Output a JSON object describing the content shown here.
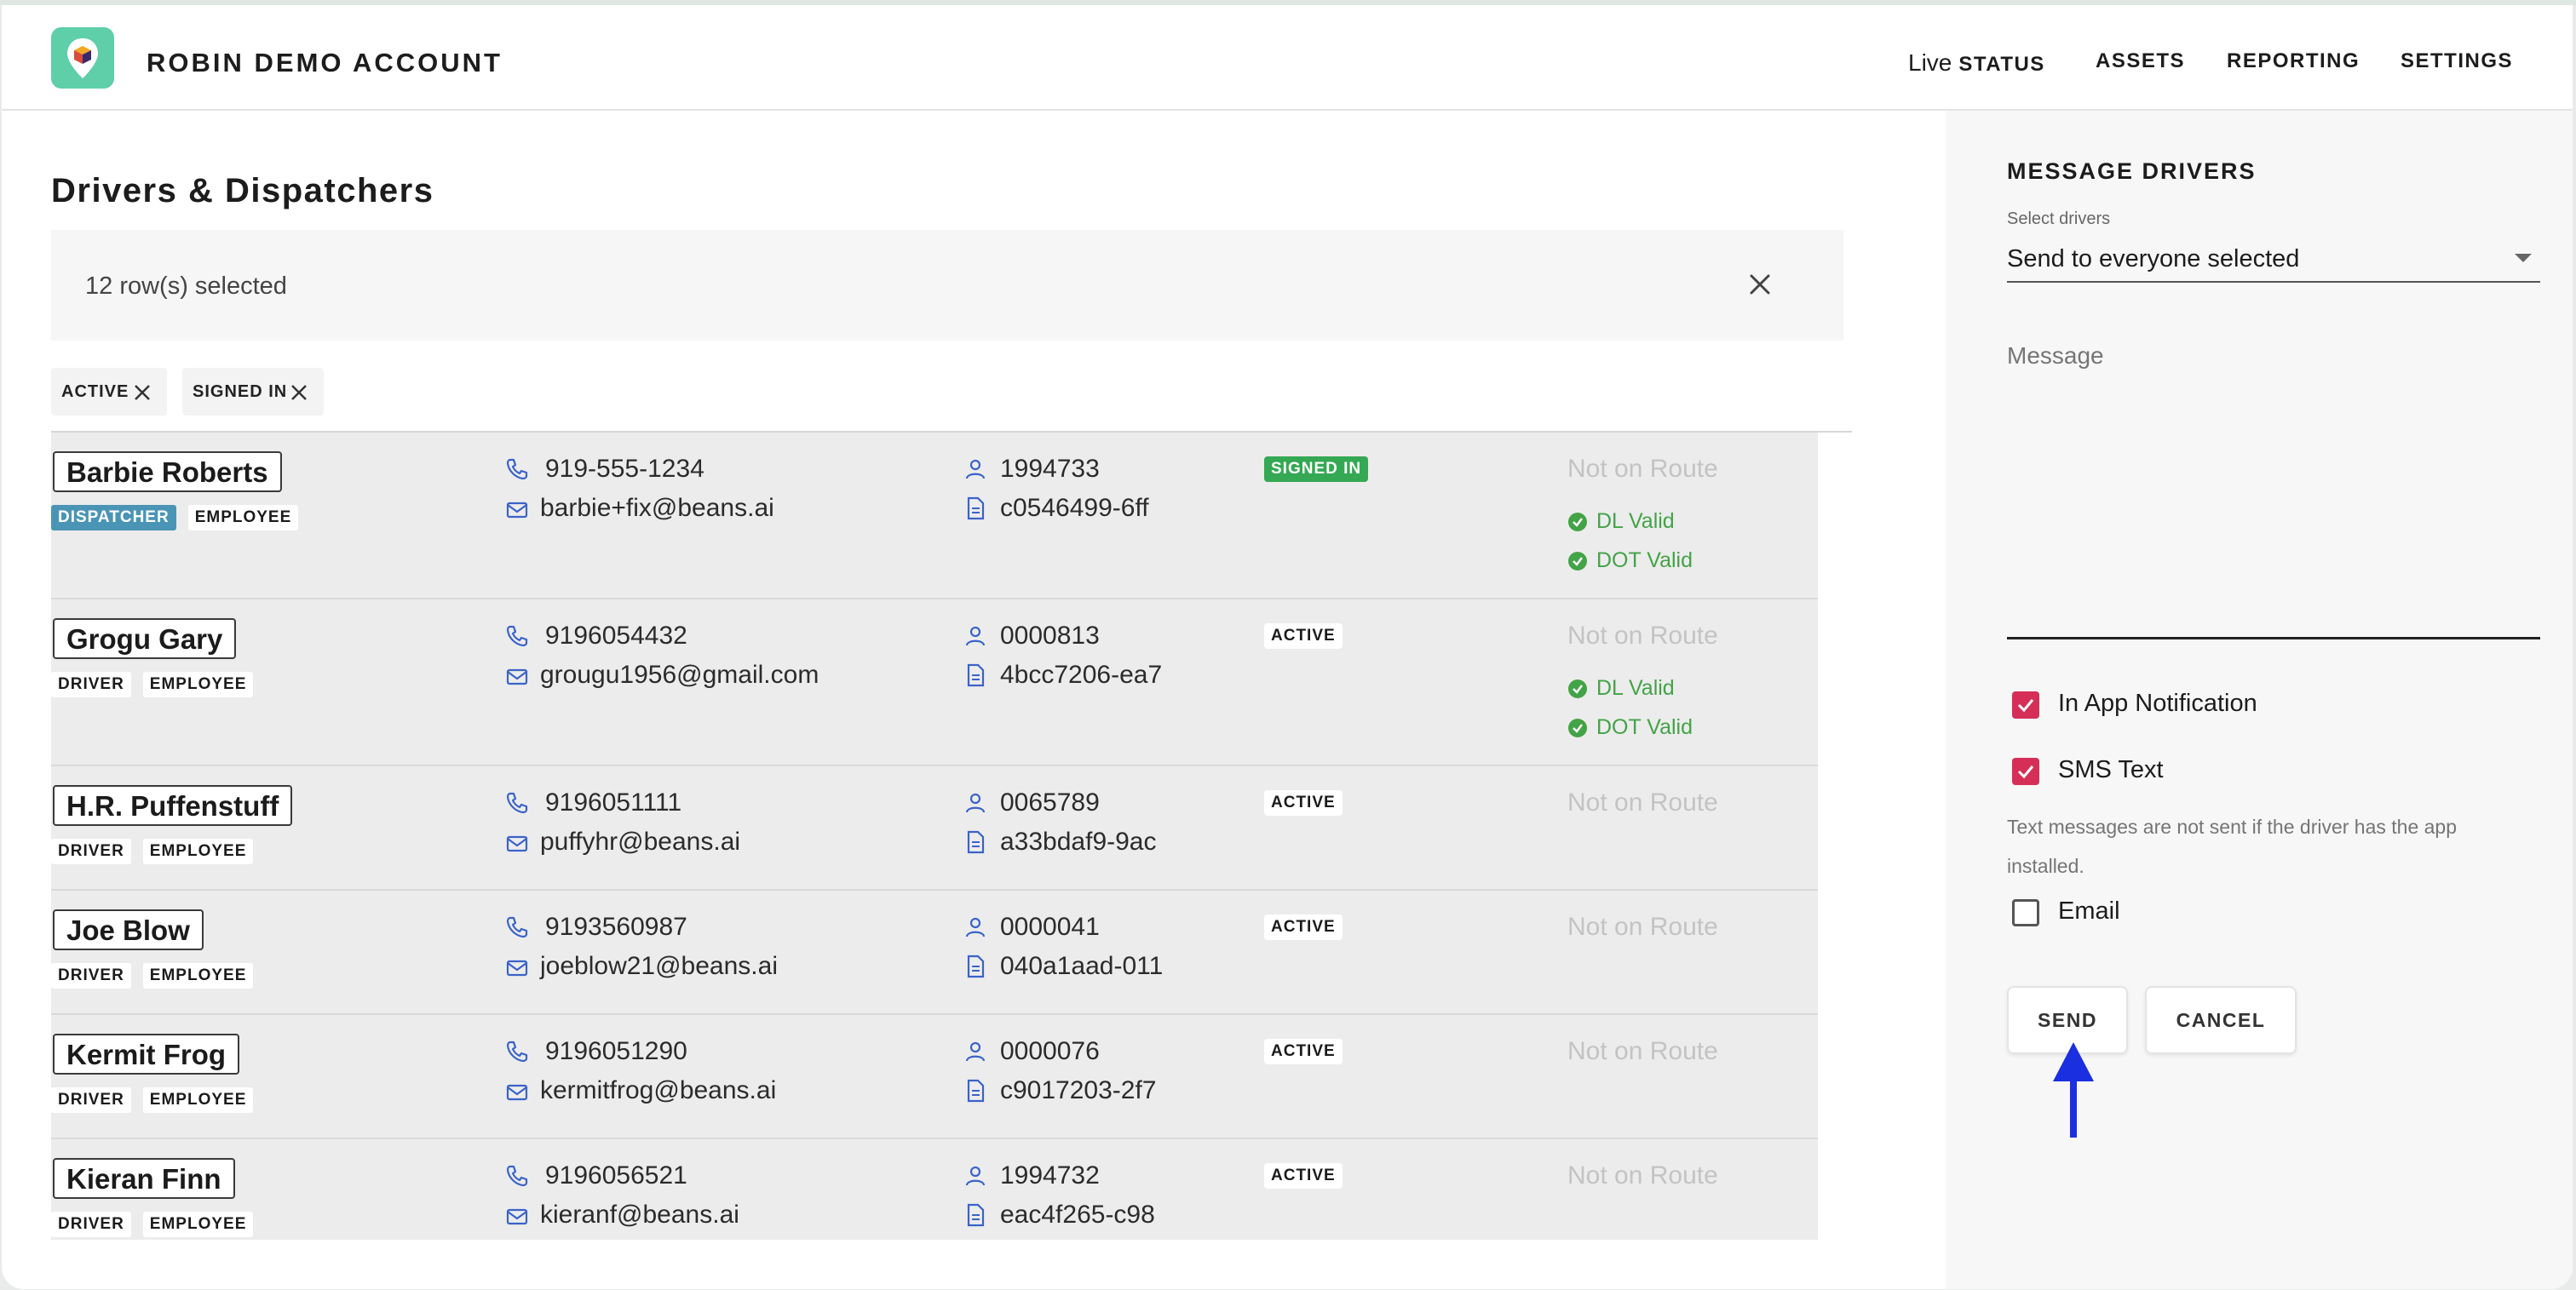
{
  "header": {
    "brand": "ROBIN DEMO ACCOUNT",
    "nav": [
      {
        "prefix": "Live",
        "label": "STATUS"
      },
      {
        "label": "ASSETS"
      },
      {
        "label": "REPORTING"
      },
      {
        "label": "SETTINGS"
      }
    ]
  },
  "main": {
    "title": "Drivers & Dispatchers",
    "selection_text": "12 row(s) selected",
    "filters": [
      "ACTIVE",
      "SIGNED IN"
    ]
  },
  "rows": [
    {
      "name": "Barbie Roberts",
      "tags": [
        "DISPATCHER",
        "EMPLOYEE"
      ],
      "phone": "919-555-1234",
      "email": "barbie+fix@beans.ai",
      "user_id": "1994733",
      "doc_id": "c0546499-6ff",
      "status": "SIGNED IN",
      "route": "Not on Route",
      "dl": "DL Valid",
      "dot": "DOT Valid"
    },
    {
      "name": "Grogu Gary",
      "tags": [
        "DRIVER",
        "EMPLOYEE"
      ],
      "phone": "9196054432",
      "email": "grougu1956@gmail.com",
      "user_id": "0000813",
      "doc_id": "4bcc7206-ea7",
      "status": "ACTIVE",
      "route": "Not on Route",
      "dl": "DL Valid",
      "dot": "DOT Valid"
    },
    {
      "name": "H.R. Puffenstuff",
      "tags": [
        "DRIVER",
        "EMPLOYEE"
      ],
      "phone": "9196051111",
      "email": "puffyhr@beans.ai",
      "user_id": "0065789",
      "doc_id": "a33bdaf9-9ac",
      "status": "ACTIVE",
      "route": "Not on Route"
    },
    {
      "name": "Joe Blow",
      "tags": [
        "DRIVER",
        "EMPLOYEE"
      ],
      "phone": "9193560987",
      "email": "joeblow21@beans.ai",
      "user_id": "0000041",
      "doc_id": "040a1aad-011",
      "status": "ACTIVE",
      "route": "Not on Route"
    },
    {
      "name": "Kermit Frog",
      "tags": [
        "DRIVER",
        "EMPLOYEE"
      ],
      "phone": "9196051290",
      "email": "kermitfrog@beans.ai",
      "user_id": "0000076",
      "doc_id": "c9017203-2f7",
      "status": "ACTIVE",
      "route": "Not on Route"
    },
    {
      "name": "Kieran Finn",
      "tags": [
        "DRIVER",
        "EMPLOYEE"
      ],
      "phone": "9196056521",
      "email": "kieranf@beans.ai",
      "user_id": "1994732",
      "doc_id": "eac4f265-c98",
      "status": "ACTIVE",
      "route": "Not on Route"
    }
  ],
  "panel": {
    "title": "MESSAGE DRIVERS",
    "select_label": "Select drivers",
    "select_value": "Send to everyone selected",
    "message_placeholder": "Message",
    "in_app_label": "In App Notification",
    "in_app_checked": true,
    "sms_label": "SMS Text",
    "sms_checked": true,
    "hint": "Text messages are not sent if the driver has the app installed.",
    "email_label": "Email",
    "email_checked": false,
    "send_label": "SEND",
    "cancel_label": "CANCEL"
  },
  "colors": {
    "brand": "#5ecfa9",
    "dispatcher_tag": "#4a95b5",
    "signed_in": "#34a853",
    "valid": "#43a347",
    "checkbox": "#d52f58",
    "icon_blue": "#3a63c9",
    "arrow": "#1a2fe0"
  }
}
